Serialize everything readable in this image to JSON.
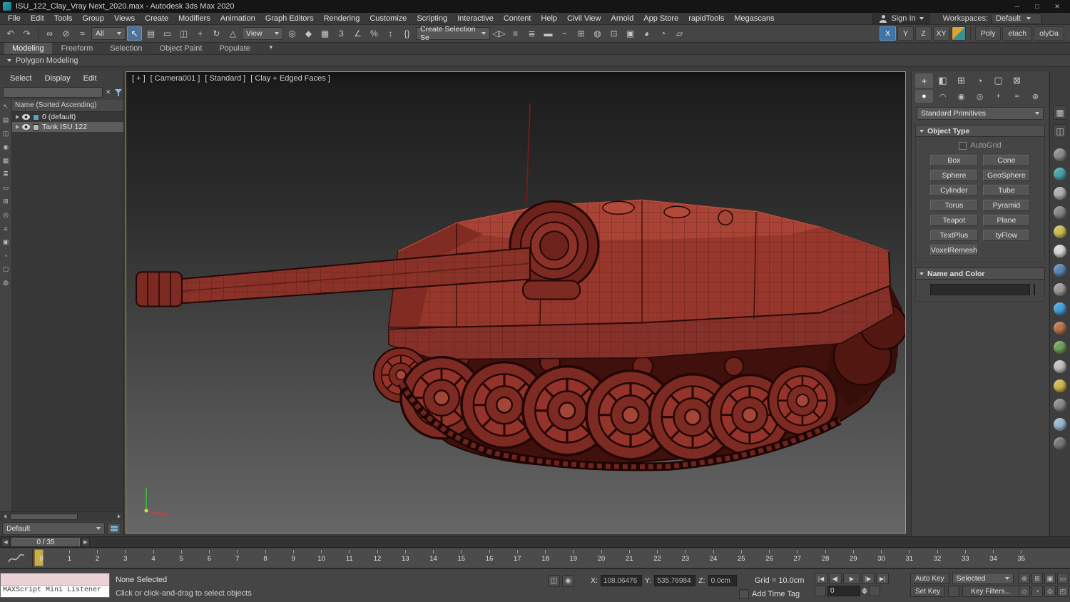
{
  "titlebar": {
    "title": "ISU_122_Clay_Vray Next_2020.max - Autodesk 3ds Max 2020",
    "controls": [
      {
        "name": "minimize-button",
        "glyph": "─"
      },
      {
        "name": "maximize-button",
        "glyph": "□"
      },
      {
        "name": "close-button",
        "glyph": "✕"
      }
    ]
  },
  "menubar": {
    "items": [
      "File",
      "Edit",
      "Tools",
      "Group",
      "Views",
      "Create",
      "Modifiers",
      "Animation",
      "Graph Editors",
      "Rendering",
      "Customize",
      "Scripting",
      "Interactive",
      "Content",
      "Help",
      "Civil View",
      "Arnold",
      "App Store",
      "rapidTools",
      "Megascans"
    ],
    "sign_in": "Sign In",
    "workspaces_label": "Workspaces:",
    "workspace_value": "Default"
  },
  "toolbar": {
    "filter_value": "All",
    "coord_value": "View",
    "selection_set_value": "Create Selection Se",
    "icons_a": [
      {
        "name": "undo-icon",
        "glyph": "↶"
      },
      {
        "name": "redo-icon",
        "glyph": "↷"
      }
    ],
    "icons_b": [
      {
        "name": "select-link-icon",
        "glyph": "∞"
      },
      {
        "name": "unlink-icon",
        "glyph": "⊘"
      },
      {
        "name": "bind-spacewarp-icon",
        "glyph": "≈"
      }
    ],
    "icons_c": [
      {
        "name": "select-object-icon",
        "glyph": "↖",
        "active": true
      },
      {
        "name": "select-by-name-icon",
        "glyph": "▤"
      },
      {
        "name": "rect-selection-region-icon",
        "glyph": "▭"
      },
      {
        "name": "window-crossing-icon",
        "glyph": "◫"
      },
      {
        "name": "move-icon",
        "glyph": "+"
      },
      {
        "name": "rotate-icon",
        "glyph": "↻"
      },
      {
        "name": "scale-icon",
        "glyph": "△"
      }
    ],
    "icons_d": [
      {
        "name": "use-pivot-center-icon",
        "glyph": "◎"
      },
      {
        "name": "select-manipulate-icon",
        "glyph": "◆"
      },
      {
        "name": "keyboard-override-icon",
        "glyph": "▦"
      },
      {
        "name": "snaps-toggle-icon",
        "glyph": "3"
      },
      {
        "name": "angle-snap-icon",
        "glyph": "∠"
      },
      {
        "name": "percent-snap-icon",
        "glyph": "%"
      },
      {
        "name": "spinner-snap-icon",
        "glyph": "↕"
      },
      {
        "name": "named-selection-sets-icon",
        "glyph": "{}"
      }
    ],
    "icons_e": [
      {
        "name": "mirror-icon",
        "glyph": "◁▷"
      },
      {
        "name": "align-icon",
        "glyph": "≡"
      },
      {
        "name": "layer-manager-icon",
        "glyph": "≣"
      },
      {
        "name": "ribbon-toggle-icon",
        "glyph": "▬"
      },
      {
        "name": "curve-editor-icon",
        "glyph": "~"
      },
      {
        "name": "schematic-view-icon",
        "glyph": "⊞"
      },
      {
        "name": "material-editor-icon",
        "glyph": "◍"
      },
      {
        "name": "render-setup-icon",
        "glyph": "⊡"
      },
      {
        "name": "rendered-frame-icon",
        "glyph": "▣"
      },
      {
        "name": "render-production-icon",
        "glyph": "◕"
      },
      {
        "name": "render-iterative-icon",
        "glyph": "◔"
      },
      {
        "name": "open-arnold-icon",
        "glyph": "▱"
      }
    ],
    "axis_buttons": [
      {
        "name": "axis-x-button",
        "label": "X",
        "active": true
      },
      {
        "name": "axis-y-button",
        "label": "Y"
      },
      {
        "name": "axis-z-button",
        "label": "Z"
      },
      {
        "name": "axis-xy-button",
        "label": "XY"
      }
    ],
    "custom_buttons": [
      {
        "name": "poly-button",
        "label": "Poly"
      },
      {
        "name": "detach-button",
        "label": "etach"
      },
      {
        "name": "polydamage-button",
        "label": "olyDa"
      }
    ]
  },
  "ribbon": {
    "tabs": [
      {
        "name": "tab-modeling",
        "label": "Modeling",
        "active": true
      },
      {
        "name": "tab-freeform",
        "label": "Freeform"
      },
      {
        "name": "tab-selection",
        "label": "Selection"
      },
      {
        "name": "tab-object-paint",
        "label": "Object Paint"
      },
      {
        "name": "tab-populate",
        "label": "Populate"
      }
    ],
    "panel_label": "Polygon Modeling"
  },
  "scene_explorer": {
    "menus": [
      "Select",
      "Display",
      "Edit"
    ],
    "clear_glyph": "✕",
    "column_header": "Name (Sorted Ascending)",
    "rows": [
      {
        "label": "0 (default)"
      },
      {
        "label": "Tank ISU 122"
      }
    ],
    "tool_icons": [
      "↖",
      "▤",
      "◫",
      "◉",
      "▦",
      "≣",
      "▭",
      "⊞",
      "◎",
      "≡",
      "▣",
      "◔",
      "▢",
      "◍"
    ],
    "footer_layer": "Default"
  },
  "viewport": {
    "label_segments": [
      "[ + ]",
      "[ Camera001 ]",
      "[ Standard ]",
      "[ Clay + Edged Faces ]"
    ]
  },
  "command_panel": {
    "tabs": [
      {
        "name": "create-tab",
        "glyph": "+",
        "active": true
      },
      {
        "name": "modify-tab",
        "glyph": "◧"
      },
      {
        "name": "hierarchy-tab",
        "glyph": "⊞"
      },
      {
        "name": "motion-tab",
        "glyph": "◔"
      },
      {
        "name": "display-tab",
        "glyph": "▢"
      },
      {
        "name": "utilities-tab",
        "glyph": "⊠"
      }
    ],
    "categories": [
      {
        "name": "geometry-category",
        "glyph": "●",
        "active": true
      },
      {
        "name": "shapes-category",
        "glyph": "◠"
      },
      {
        "name": "lights-category",
        "glyph": "◉"
      },
      {
        "name": "cameras-category",
        "glyph": "◎"
      },
      {
        "name": "helpers-category",
        "glyph": "+"
      },
      {
        "name": "spacewarps-category",
        "glyph": "≈"
      },
      {
        "name": "systems-category",
        "glyph": "⊛"
      }
    ],
    "primitive_dropdown": "Standard Primitives",
    "object_type": {
      "title": "Object Type",
      "autogrid_label": "AutoGrid",
      "buttons": [
        "Box",
        "Cone",
        "Sphere",
        "GeoSphere",
        "Cylinder",
        "Tube",
        "Torus",
        "Pyramid",
        "Teapot",
        "Plane",
        "TextPlus",
        "tyFlow",
        "VoxelRemesh"
      ]
    },
    "name_color": {
      "title": "Name and Color"
    }
  },
  "right_dock": {
    "squares": [
      {
        "name": "viewport-layout-icon",
        "glyph": "▦"
      },
      {
        "name": "viewport-layout-alt-icon",
        "glyph": "◫"
      }
    ],
    "spheres": [
      {
        "name": "dock-icon",
        "color": "#8d8d8d"
      },
      {
        "name": "dock-icon",
        "color": "#49a0a8"
      },
      {
        "name": "dock-icon",
        "color": "#b0b0b0"
      },
      {
        "name": "dock-icon",
        "color": "#888888"
      },
      {
        "name": "dock-icon",
        "color": "#cdbd55"
      },
      {
        "name": "dock-icon",
        "color": "#d8d8d8"
      },
      {
        "name": "dock-icon",
        "color": "#5d86b8"
      },
      {
        "name": "dock-icon",
        "color": "#9a9a9a"
      },
      {
        "name": "dock-icon",
        "color": "#45a0d8"
      },
      {
        "name": "dock-icon",
        "color": "#b8734d"
      },
      {
        "name": "dock-icon",
        "color": "#6fa05a"
      },
      {
        "name": "dock-icon",
        "color": "#c0c0c0"
      },
      {
        "name": "dock-icon",
        "color": "#d0b84a"
      },
      {
        "name": "dock-icon",
        "color": "#8a8a8a"
      },
      {
        "name": "dock-icon",
        "color": "#9ab8d0"
      },
      {
        "name": "dock-icon",
        "color": "#777777"
      }
    ]
  },
  "timeline": {
    "slider_value": "0 / 35",
    "back_glyph": "◀",
    "fwd_glyph": "▶",
    "ticks": [
      "0",
      "1",
      "2",
      "3",
      "4",
      "5",
      "6",
      "7",
      "8",
      "9",
      "10",
      "11",
      "12",
      "13",
      "14",
      "15",
      "16",
      "17",
      "18",
      "19",
      "20",
      "21",
      "22",
      "23",
      "24",
      "25",
      "26",
      "27",
      "28",
      "29",
      "30",
      "31",
      "32",
      "33",
      "34",
      "35"
    ]
  },
  "statusbar": {
    "listener_label": "MAXScript Mini Listener",
    "selection_status": "None Selected",
    "prompt": "Click or click-and-drag to select objects",
    "pre_icons": [
      {
        "name": "crossing-selection-icon",
        "glyph": "◫"
      },
      {
        "name": "selection-lock-icon",
        "glyph": "◉"
      }
    ],
    "coords": {
      "x_label": "X:",
      "x_value": "108.06476",
      "y_label": "Y:",
      "y_value": "535.76984",
      "z_label": "Z:",
      "z_value": "0.0cm"
    },
    "grid_label": "Grid = 10.0cm",
    "add_time_tag": "Add Time Tag",
    "playback": [
      {
        "name": "go-to-start-button",
        "glyph": "|◀"
      },
      {
        "name": "previous-frame-button",
        "glyph": "◀|"
      },
      {
        "name": "play-button",
        "glyph": "▶",
        "w": 24
      },
      {
        "name": "next-frame-button",
        "glyph": "|▶"
      },
      {
        "name": "go-to-end-button",
        "glyph": "▶|"
      }
    ],
    "frame_value": "0",
    "auto_key": "Auto Key",
    "set_key": "Set Key",
    "selected_dropdown": "Selected",
    "key_filters": "Key Filters...",
    "nav_row1": [
      {
        "name": "zoom-icon",
        "glyph": "⊕"
      },
      {
        "name": "zoom-all-icon",
        "glyph": "⊞"
      },
      {
        "name": "zoom-extents-icon",
        "glyph": "▣"
      },
      {
        "name": "zoom-region-icon",
        "glyph": "▭"
      }
    ],
    "nav_row2": [
      {
        "name": "pan-icon",
        "glyph": "◇"
      },
      {
        "name": "orbit-icon",
        "glyph": "◔"
      },
      {
        "name": "walk-through-icon",
        "glyph": "◎"
      },
      {
        "name": "maximize-viewport-icon",
        "glyph": "◰"
      }
    ]
  },
  "colors": {
    "clay_red": "#97372c",
    "viewport_border": "#b9992c",
    "accent_blue": "#3e74a8"
  }
}
